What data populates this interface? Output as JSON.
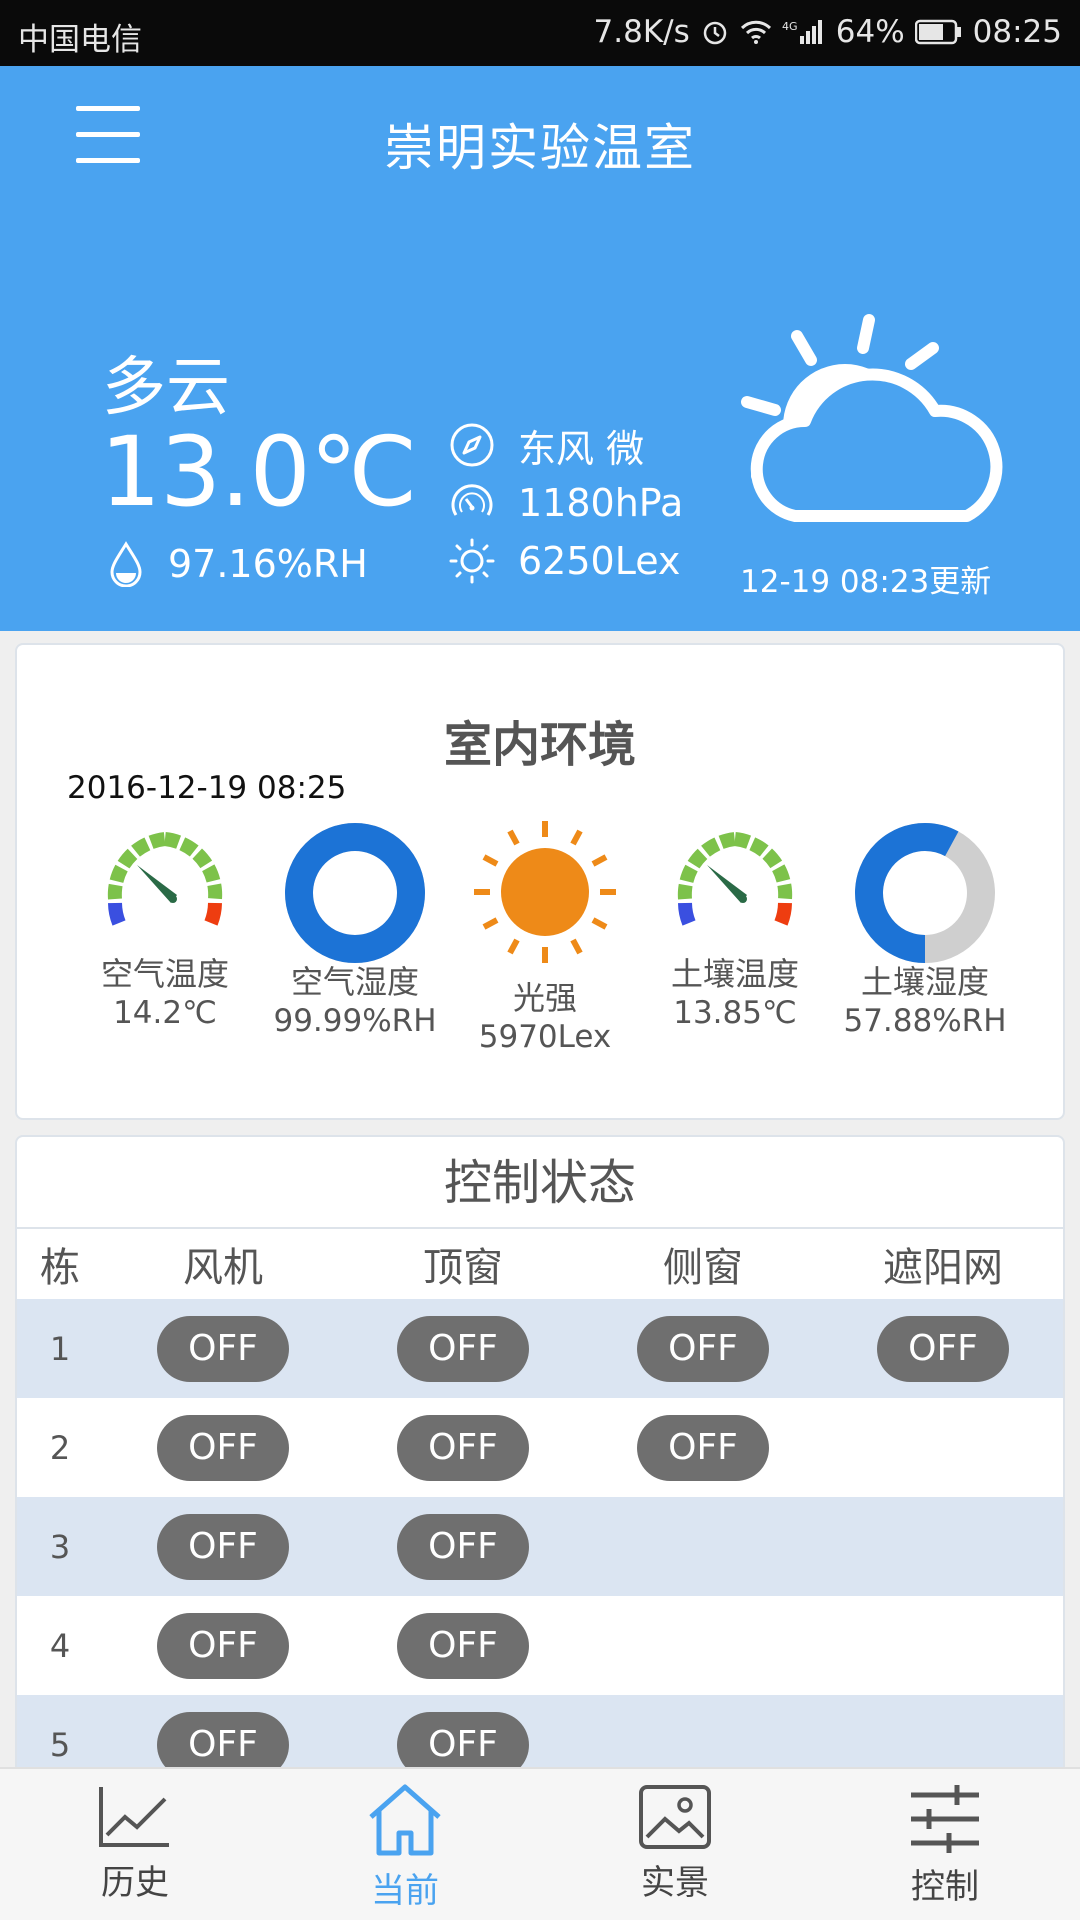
{
  "status": {
    "carrier": "中国电信",
    "speed": "7.8K/s",
    "battery": "64%",
    "time": "08:25",
    "network": "4G"
  },
  "header": {
    "title": "崇明实验温室",
    "weather": "多云",
    "temperature": "13.0℃",
    "humidity": "97.16%RH",
    "wind": "东风 微",
    "pressure": "1180hPa",
    "light": "6250Lex",
    "updated": "12-19 08:23更新"
  },
  "indoor": {
    "title": "室内环境",
    "timestamp": "2016-12-19 08:25",
    "items": [
      {
        "label": "空气温度",
        "value": "14.2℃"
      },
      {
        "label": "空气湿度",
        "value": "99.99%RH",
        "fraction": 0.9999
      },
      {
        "label": "光强",
        "value": "5970Lex"
      },
      {
        "label": "土壤温度",
        "value": "13.85℃"
      },
      {
        "label": "土壤湿度",
        "value": "57.88%RH",
        "fraction": 0.5788
      }
    ]
  },
  "control": {
    "title": "控制状态",
    "columns": [
      "栋",
      "风机",
      "顶窗",
      "侧窗",
      "遮阳网"
    ],
    "off_label": "OFF",
    "rows": [
      {
        "id": "1",
        "fan": "OFF",
        "top": "OFF",
        "side": "OFF",
        "shade": "OFF"
      },
      {
        "id": "2",
        "fan": "OFF",
        "top": "OFF",
        "side": "OFF"
      },
      {
        "id": "3",
        "fan": "OFF",
        "top": "OFF"
      },
      {
        "id": "4",
        "fan": "OFF",
        "top": "OFF"
      },
      {
        "id": "5",
        "fan": "OFF",
        "top": "OFF"
      }
    ]
  },
  "nav": {
    "items": [
      {
        "label": "历史",
        "icon": "chart-icon"
      },
      {
        "label": "当前",
        "icon": "home-icon",
        "active": true
      },
      {
        "label": "实景",
        "icon": "image-icon"
      },
      {
        "label": "控制",
        "icon": "sliders-icon"
      }
    ]
  },
  "colors": {
    "primary": "#4aa3f0",
    "donut": "#1c73d6",
    "sun": "#ee8a18",
    "button": "#6f6f6f",
    "row_alt": "#dbe5f2"
  }
}
